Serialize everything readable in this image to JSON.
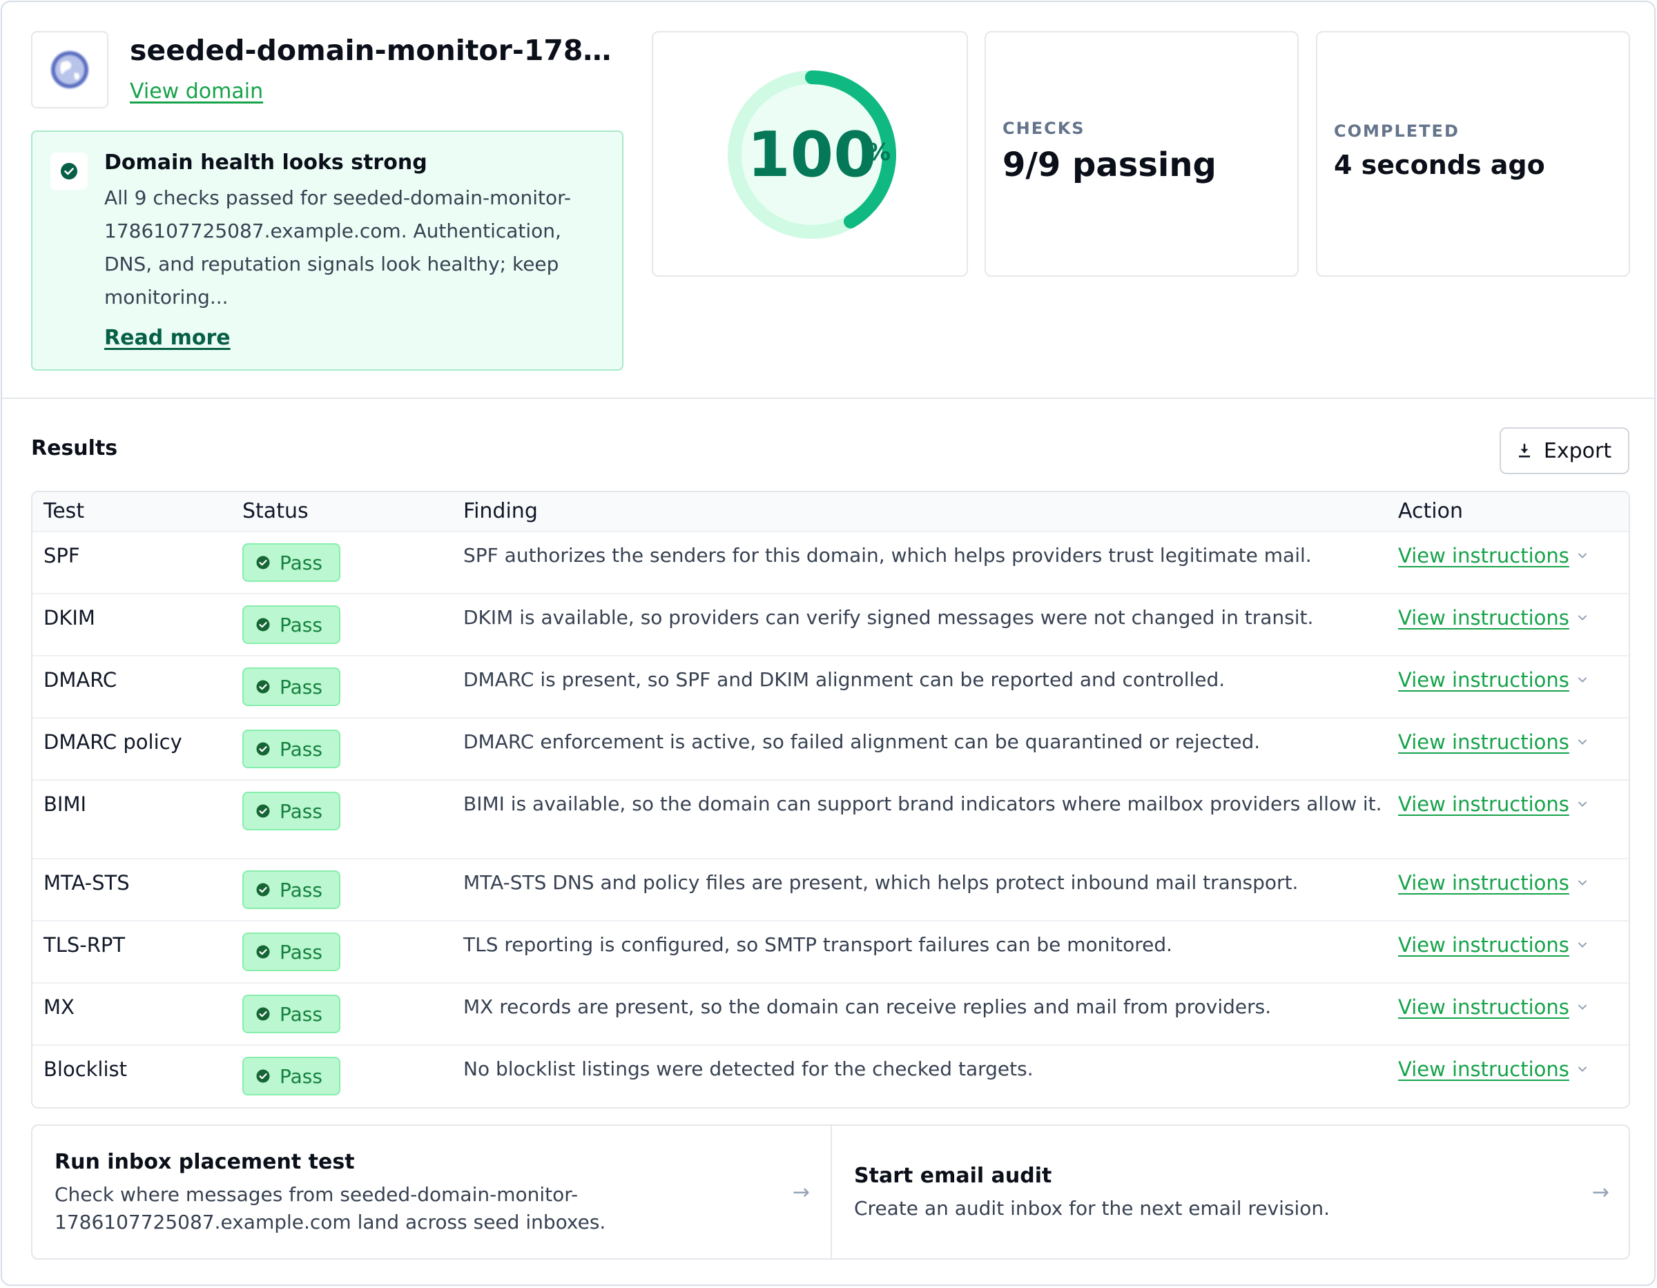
{
  "header": {
    "domain_name": "seeded-domain-monitor-1786...",
    "view_domain_label": "View domain",
    "favicon_icon": "globe-icon"
  },
  "health": {
    "title": "Domain health looks strong",
    "body": "All 9 checks passed for seeded-domain-monitor-1786107725087.example.com. Authentication, DNS, and reputation signals look healthy; keep monitoring...",
    "read_more_label": "Read more",
    "icon": "check-circle-icon"
  },
  "score": {
    "value": "100",
    "unit": "%",
    "fraction": 1.0,
    "color": "#10b981"
  },
  "checks_card": {
    "label": "CHECKS",
    "value": "9/9 passing"
  },
  "completed_card": {
    "label": "COMPLETED",
    "value": "4 seconds ago"
  },
  "results": {
    "title": "Results",
    "export_label": "Export",
    "export_icon": "download-icon",
    "columns": [
      "Test",
      "Status",
      "Finding",
      "Action"
    ],
    "action_label": "View instructions",
    "status_label": "Pass",
    "rows": [
      {
        "test": "SPF",
        "finding": "SPF authorizes the senders for this domain, which helps providers trust legitimate mail."
      },
      {
        "test": "DKIM",
        "finding": "DKIM is available, so providers can verify signed messages were not changed in transit."
      },
      {
        "test": "DMARC",
        "finding": "DMARC is present, so SPF and DKIM alignment can be reported and controlled."
      },
      {
        "test": "DMARC policy",
        "finding": "DMARC enforcement is active, so failed alignment can be quarantined or rejected."
      },
      {
        "test": "BIMI",
        "finding": "BIMI is available, so the domain can support brand indicators where mailbox providers allow it."
      },
      {
        "test": "MTA-STS",
        "finding": "MTA-STS DNS and policy files are present, which helps protect inbound mail transport."
      },
      {
        "test": "TLS-RPT",
        "finding": "TLS reporting is configured, so SMTP transport failures can be monitored."
      },
      {
        "test": "MX",
        "finding": "MX records are present, so the domain can receive replies and mail from providers."
      },
      {
        "test": "Blocklist",
        "finding": "No blocklist listings were detected for the checked targets."
      }
    ]
  },
  "actions": {
    "inbox": {
      "title": "Run inbox placement test",
      "desc": "Check where messages from seeded-domain-monitor-1786107725087.example.com land across seed inboxes."
    },
    "audit": {
      "title": "Start email audit",
      "desc": "Create an audit inbox for the next email revision."
    }
  }
}
